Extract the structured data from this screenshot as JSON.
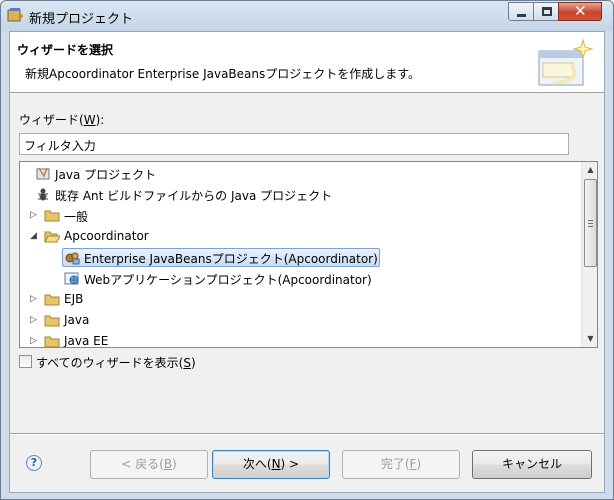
{
  "window": {
    "title": "新規プロジェクト"
  },
  "header": {
    "title": "ウィザードを選択",
    "description": "新規Apcoordinator Enterprise JavaBeansプロジェクトを作成します。"
  },
  "wizards": {
    "label_prefix": "ウィザード(",
    "label_key": "W",
    "label_suffix": "):",
    "filter_value": "フィルタ入力"
  },
  "tree": {
    "items": [
      {
        "label": "Java プロジェクト",
        "icon": "java-project-icon",
        "depth": 0,
        "expander": "none",
        "selected": false
      },
      {
        "label": "既存 Ant ビルドファイルからの Java プロジェクト",
        "icon": "ant-icon",
        "depth": 0,
        "expander": "none",
        "selected": false
      },
      {
        "label": "一般",
        "icon": "folder-icon",
        "depth": 0,
        "expander": "collapsed",
        "selected": false
      },
      {
        "label": "Apcoordinator",
        "icon": "folder-open-icon",
        "depth": 0,
        "expander": "expanded",
        "selected": false
      },
      {
        "label": "Enterprise JavaBeansプロジェクト(Apcoordinator)",
        "icon": "ejb-project-icon",
        "depth": 1,
        "expander": "none",
        "selected": true
      },
      {
        "label": "Webアプリケーションプロジェクト(Apcoordinator)",
        "icon": "web-project-icon",
        "depth": 1,
        "expander": "none",
        "selected": false
      },
      {
        "label": "EJB",
        "icon": "folder-icon",
        "depth": 0,
        "expander": "collapsed",
        "selected": false
      },
      {
        "label": "Java",
        "icon": "folder-icon",
        "depth": 0,
        "expander": "collapsed",
        "selected": false
      },
      {
        "label": "Java EE",
        "icon": "folder-icon",
        "depth": 0,
        "expander": "collapsed",
        "selected": false
      }
    ]
  },
  "show_all": {
    "label_prefix": "すべてのウィザードを表示(",
    "label_key": "S",
    "label_suffix": ")",
    "checked": false
  },
  "buttons": {
    "back_prefix": "< 戻る(",
    "back_key": "B",
    "back_suffix": ")",
    "next_prefix": "次へ(",
    "next_key": "N",
    "next_suffix": ") >",
    "finish_prefix": "完了(",
    "finish_key": "F",
    "finish_suffix": ")",
    "cancel": "キャンセル"
  },
  "colors": {
    "selection": "#cce4f7",
    "close_button": "#c7452b",
    "folder": "#e8c46a"
  }
}
